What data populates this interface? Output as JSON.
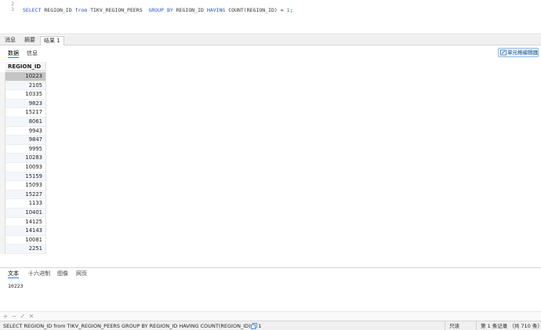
{
  "editor": {
    "line_numbers": [
      "2",
      "3"
    ],
    "sql": {
      "kw_select": "SELECT",
      "col": " REGION_ID ",
      "kw_from": "from",
      "table": " TIKV_REGION_PEERS  ",
      "kw_group_by": "GROUP BY",
      "group_col": " REGION_ID ",
      "kw_having": "HAVING",
      "fn_count": " COUNT(REGION_ID) = ",
      "value": "1",
      "end": ";"
    }
  },
  "result_tabs": [
    "消息",
    "摘要",
    "结果 1"
  ],
  "sub_tabs": [
    "数据",
    "信息"
  ],
  "cell_editor_label": "单元格编辑器",
  "grid": {
    "column": "REGION_ID",
    "rows": [
      "10223",
      "2105",
      "10335",
      "9823",
      "15217",
      "8061",
      "9943",
      "9847",
      "9995",
      "10283",
      "10093",
      "15159",
      "15093",
      "15227",
      "1133",
      "10401",
      "14125",
      "14143",
      "10081",
      "2251"
    ]
  },
  "bottom_tabs": [
    "文本",
    "十六进制",
    "图像",
    "网页"
  ],
  "bottom_text_value": "10223",
  "record_toolbar": [
    "+",
    "−",
    "✓",
    "✕"
  ],
  "status": {
    "sql": "SELECT REGION_ID from TIKV_REGION_PEERS  GROUP BY REGION_ID HAVING COUNT(REGION_ID) = 1",
    "mode": "只读",
    "count": "第 1 条记录 （共 710 条）"
  },
  "colors": {
    "accent": "#2f7bd8",
    "keyword": "#2b57c4",
    "selected_row": "#c4c4c4"
  }
}
